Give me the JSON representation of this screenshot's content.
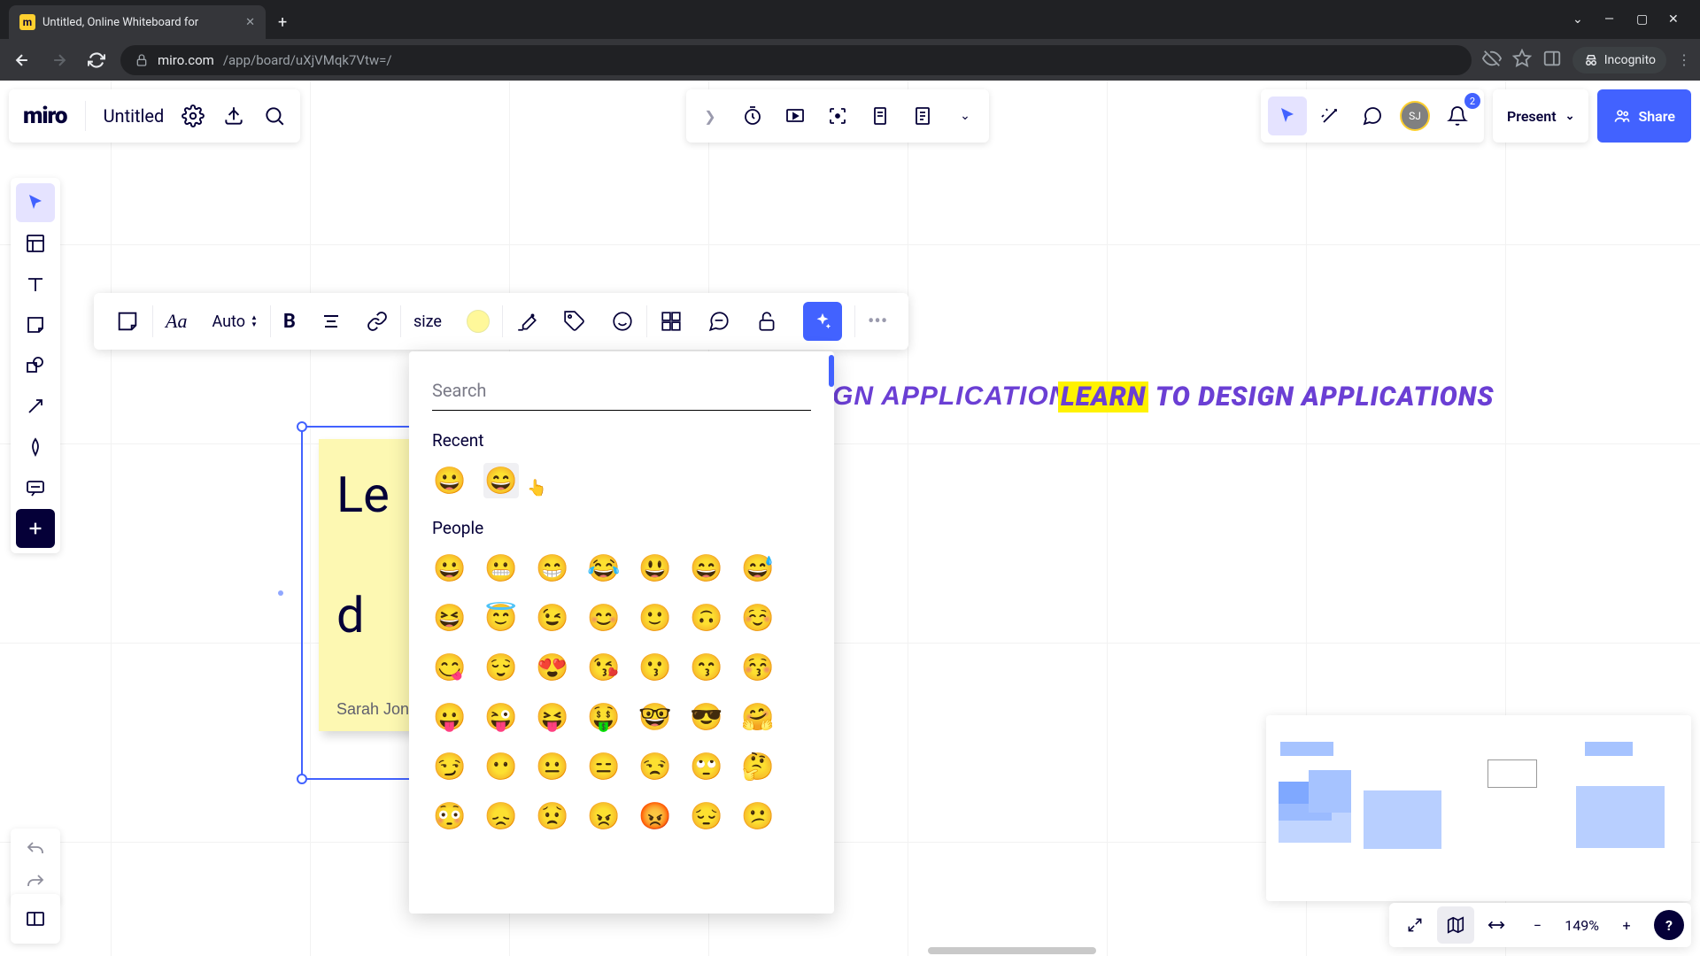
{
  "browser": {
    "tab_title": "Untitled, Online Whiteboard for",
    "url_domain": "miro.com",
    "url_path": "/app/board/uXjVMqk7Vtw=/",
    "incognito_label": "Incognito"
  },
  "header": {
    "logo": "miro",
    "board_title": "Untitled",
    "present_label": "Present",
    "share_label": "Share",
    "avatar_initials": "SJ",
    "notif_count": "2"
  },
  "context_toolbar": {
    "auto_label": "Auto",
    "size_label": "size"
  },
  "sticky": {
    "line1": "Le",
    "line2": "d",
    "author": "Sarah Jona"
  },
  "canvas_texts": {
    "t1": "GN APPLICATIONS",
    "t2_hl": "LEARN",
    "t2_rest": " TO DESIGN APPLICATIONS"
  },
  "emoji_picker": {
    "search_placeholder": "Search",
    "recent_title": "Recent",
    "people_title": "People",
    "recent": [
      "😀",
      "😄"
    ],
    "people": [
      "😀",
      "😬",
      "😁",
      "😂",
      "😃",
      "😄",
      "😅",
      "😆",
      "😇",
      "😉",
      "😊",
      "🙂",
      "🙃",
      "☺️",
      "😋",
      "😌",
      "😍",
      "😘",
      "😗",
      "😙",
      "😚",
      "😛",
      "😜",
      "😝",
      "🤑",
      "🤓",
      "😎",
      "🤗",
      "😏",
      "😶",
      "😐",
      "😑",
      "😒",
      "🙄",
      "🤔",
      "😳",
      "😞",
      "😟",
      "😠",
      "😡",
      "😔",
      "😕"
    ]
  },
  "zoom": {
    "pct": "149%"
  },
  "help": "?"
}
